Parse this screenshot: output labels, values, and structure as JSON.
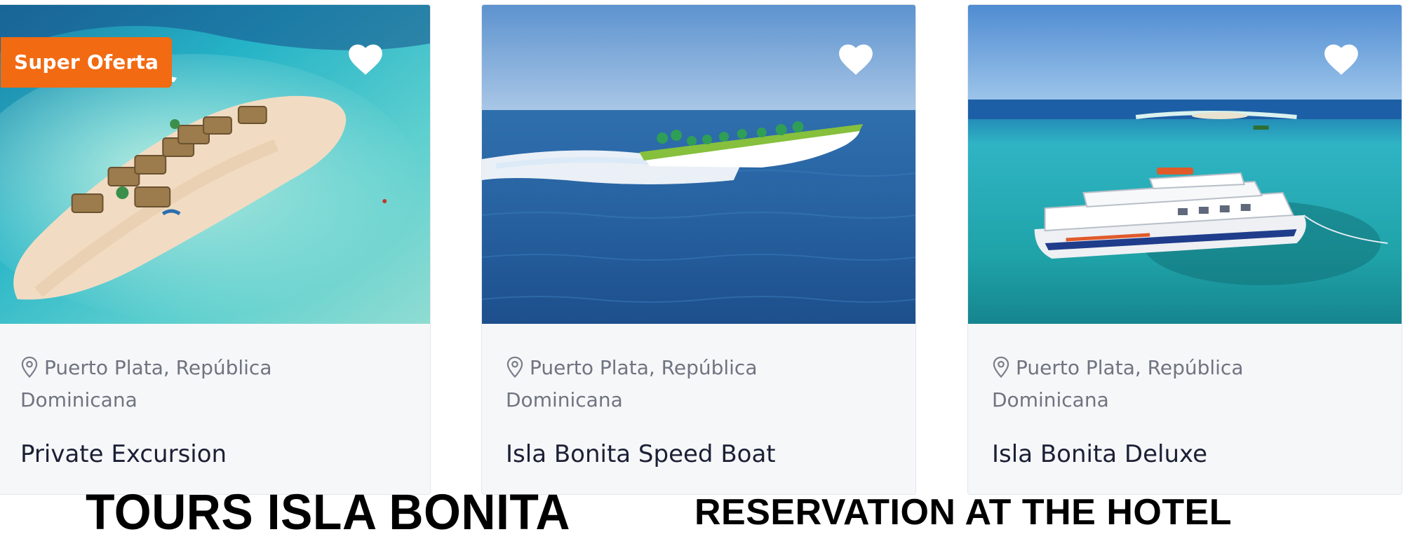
{
  "cards": [
    {
      "badge": "Super Oferta",
      "location_line1": "Puerto Plata, República",
      "location_line2": "Dominicana",
      "title": "Private Excursion",
      "icons": {
        "favorite": "heart-icon",
        "location": "location-pin-icon"
      }
    },
    {
      "location_line1": "Puerto Plata, República",
      "location_line2": "Dominicana",
      "title": "Isla Bonita Speed Boat",
      "icons": {
        "favorite": "heart-icon",
        "location": "location-pin-icon"
      }
    },
    {
      "location_line1": "Puerto Plata, República",
      "location_line2": "Dominicana",
      "title": "Isla Bonita Deluxe",
      "icons": {
        "favorite": "heart-icon",
        "location": "location-pin-icon"
      }
    }
  ],
  "captions": {
    "left": "TOURS ISLA BONITA",
    "right": "RESERVATION AT THE HOTEL"
  },
  "colors": {
    "badge": "#f26a12",
    "card_background": "#f6f7f9",
    "title_text": "#1b2035",
    "location_text": "#6f7480"
  }
}
